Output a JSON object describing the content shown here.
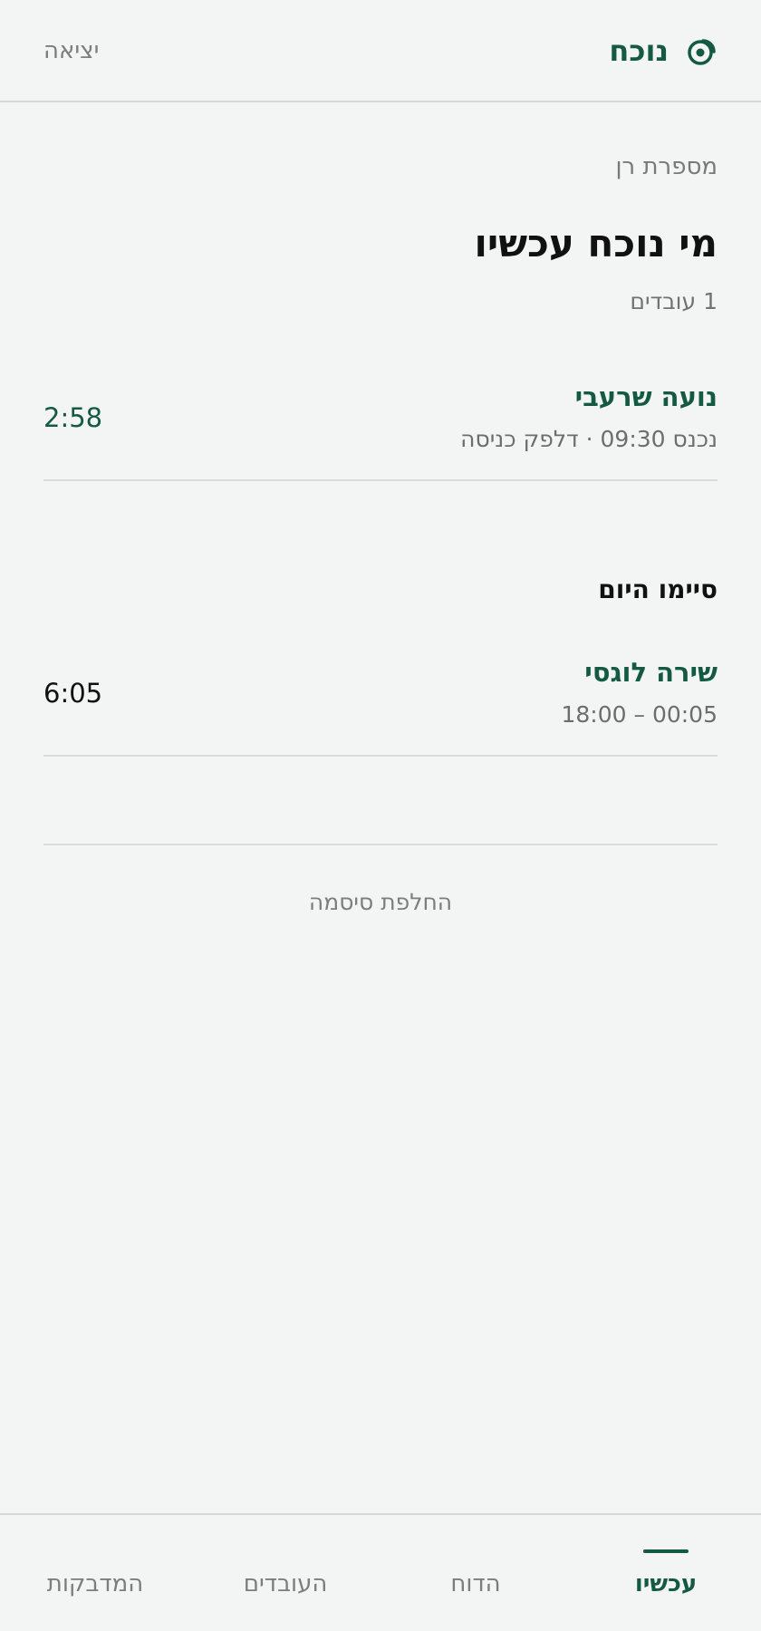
{
  "header": {
    "brand": "נוכח",
    "logout_label": "יציאה",
    "brand_color": "#145a43"
  },
  "shop": {
    "name": "מספרת רן"
  },
  "present": {
    "title": "מי נוכח עכשיו",
    "count_label": "1 עובדים",
    "employees": [
      {
        "name": "נועה שרעבי",
        "meta": "נכנס 09:30 · דלפק כניסה",
        "duration": "2:58"
      }
    ]
  },
  "finished": {
    "title": "סיימו היום",
    "employees": [
      {
        "name": "שירה לוגסי",
        "meta": "18:00 – 00:05",
        "duration": "6:05"
      }
    ]
  },
  "change_password_label": "החלפת סיסמה",
  "nav": {
    "items": [
      {
        "label": "עכשיו",
        "active": true
      },
      {
        "label": "הדוח",
        "active": false
      },
      {
        "label": "העובדים",
        "active": false
      },
      {
        "label": "המדבקות",
        "active": false
      }
    ]
  }
}
